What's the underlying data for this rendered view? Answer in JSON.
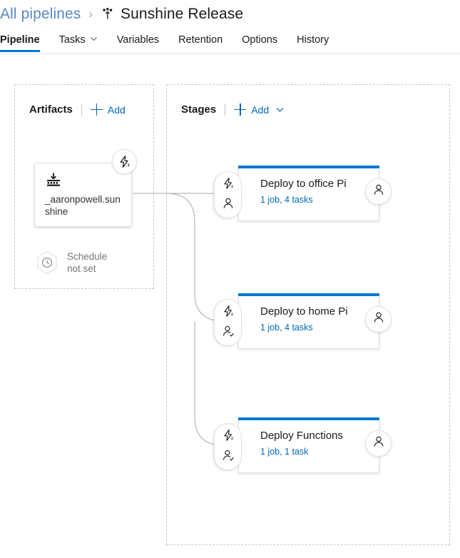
{
  "breadcrumb": {
    "parent_label": "All pipelines",
    "separator": "›",
    "icon": "release-pipeline-icon",
    "title": "Sunshine Release"
  },
  "tabs": [
    {
      "label": "Pipeline",
      "active": true,
      "has_chevron": false
    },
    {
      "label": "Tasks",
      "active": false,
      "has_chevron": true
    },
    {
      "label": "Variables",
      "active": false,
      "has_chevron": false
    },
    {
      "label": "Retention",
      "active": false,
      "has_chevron": false
    },
    {
      "label": "Options",
      "active": false,
      "has_chevron": false
    },
    {
      "label": "History",
      "active": false,
      "has_chevron": false
    }
  ],
  "artifacts_panel": {
    "title": "Artifacts",
    "add_label": "Add",
    "artifact": {
      "name": "_aaronpowell.sunshine",
      "icon": "build-artifact-icon",
      "trigger_icon": "continuous-deployment-trigger-icon"
    },
    "schedule": {
      "icon": "clock-icon",
      "line1": "Schedule",
      "line2": "not set"
    }
  },
  "stages_panel": {
    "title": "Stages",
    "add_label": "Add",
    "stages": [
      {
        "name": "Deploy to office Pi",
        "summary": "1 job, 4 tasks",
        "pre_trigger_icon": "lightning-bolt-icon",
        "pre_approval_icon": "person-icon",
        "post_approval_icon": "person-icon"
      },
      {
        "name": "Deploy to home Pi",
        "summary": "1 job, 4 tasks",
        "pre_trigger_icon": "lightning-bolt-icon",
        "pre_approval_icon": "person-check-icon",
        "post_approval_icon": "person-icon"
      },
      {
        "name": "Deploy Functions",
        "summary": "1 job, 1 task",
        "pre_trigger_icon": "lightning-bolt-icon",
        "pre_approval_icon": "person-check-icon",
        "post_approval_icon": "person-icon"
      }
    ]
  },
  "colors": {
    "accent": "#0078d4",
    "link": "#0067b8",
    "breadcrumb_link": "#5b87c5",
    "muted": "#767676",
    "panel_border": "#c8c8c8"
  }
}
